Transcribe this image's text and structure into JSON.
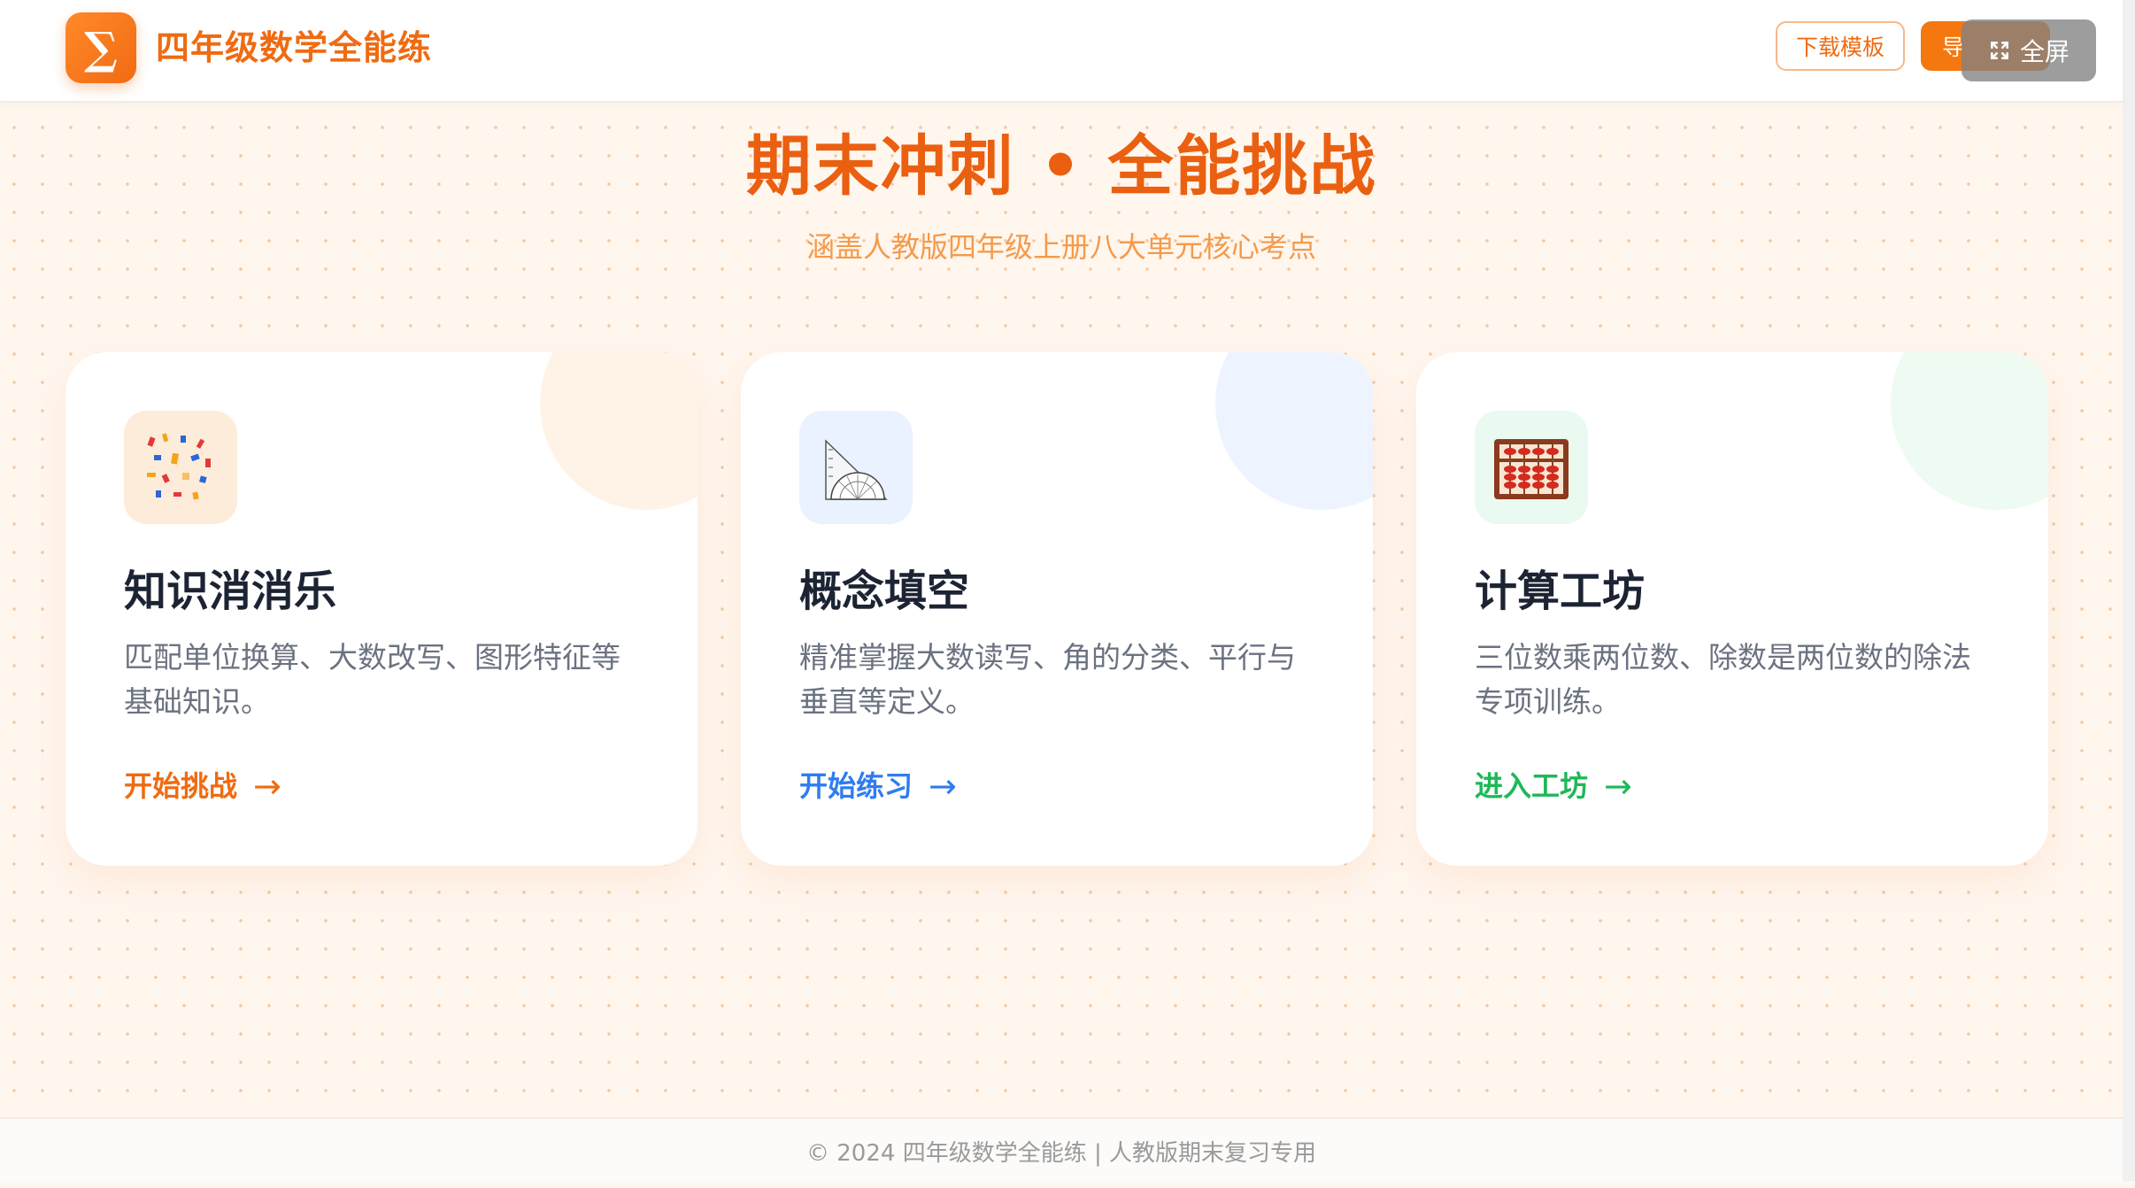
{
  "header": {
    "logo_symbol": "∑",
    "app_title": "四年级数学全能练",
    "download_template_label": "下载模板",
    "import_label": "导",
    "fullscreen_label": "全屏"
  },
  "hero": {
    "title": "期末冲刺 • 全能挑战",
    "subtitle": "涵盖人教版四年级上册八大单元核心考点"
  },
  "cards": [
    {
      "title": "知识消消乐",
      "description": "匹配单位换算、大数改写、图形特征等基础知识。",
      "action_label": "开始挑战",
      "arrow": "→",
      "icon": "puzzle-pieces-icon",
      "accent_color": "#ef6b12",
      "icon_bg": "#fdecd9",
      "deco_color": "#fff3e8"
    },
    {
      "title": "概念填空",
      "description": "精准掌握大数读写、角的分类、平行与垂直等定义。",
      "action_label": "开始练习",
      "arrow": "→",
      "icon": "protractor-ruler-icon",
      "accent_color": "#2f7cf0",
      "icon_bg": "#eaf2ff",
      "deco_color": "#eef4ff"
    },
    {
      "title": "计算工坊",
      "description": "三位数乘两位数、除数是两位数的除法专项训练。",
      "action_label": "进入工坊",
      "arrow": "→",
      "icon": "abacus-icon",
      "accent_color": "#1fb858",
      "icon_bg": "#eafaf0",
      "deco_color": "#eefbf2"
    }
  ],
  "footer": {
    "text": "© 2024 四年级数学全能练 | 人教版期末复习专用"
  }
}
